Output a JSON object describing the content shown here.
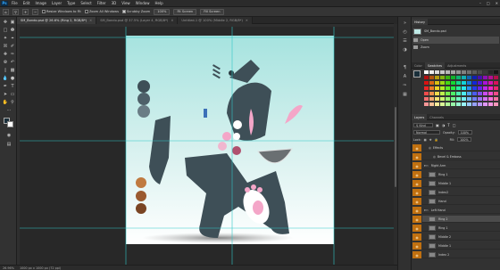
{
  "menu": {
    "items": [
      "File",
      "Edit",
      "Image",
      "Layer",
      "Type",
      "Select",
      "Filter",
      "3D",
      "View",
      "Window",
      "Help"
    ],
    "app_icon": "Ps"
  },
  "options": {
    "resize_windows": "Resize Windows to Fit",
    "zoom_all": "Zoom All Windows",
    "scrubby": "Scrubby Zoom",
    "zoom_value": "100%",
    "fit_screen": "Fit Screen",
    "fill_screen": "Fill Screen"
  },
  "tabs": [
    {
      "label": "SM_Bondo.psd @ 26.6% (Ring 2, RGB/8*)",
      "active": true
    },
    {
      "label": "SM_Bondo.psd @ 37.5% (Layer 4, RGB/8*)",
      "active": false
    },
    {
      "label": "Untitled-1 @ 100% (Middle 2, RGB/8*)",
      "active": false
    }
  ],
  "status": {
    "zoom": "26.96%",
    "doc": "1000 px x 1000 px (72 ppi)"
  },
  "history": {
    "tab": "History",
    "other_tab": "",
    "snapshot": "SM_Bondo.psd",
    "items": [
      "Open",
      "Zoom"
    ]
  },
  "swatches": {
    "tabs": [
      "Color",
      "Swatches",
      "Adjustments"
    ],
    "active": "Swatches"
  },
  "layers": {
    "tabs": [
      "Layers",
      "Channels"
    ],
    "kind_label": "Kind",
    "mode": "Normal",
    "opacity_label": "Opacity:",
    "opacity": "100%",
    "lock_label": "Lock:",
    "fill_label": "Fill:",
    "fill": "100%",
    "rows": [
      {
        "name": "Effects",
        "indent": 1,
        "type": "fx"
      },
      {
        "name": "Bevel & Emboss",
        "indent": 2,
        "type": "fx"
      },
      {
        "name": "Right Arm",
        "indent": 0,
        "type": "group"
      },
      {
        "name": "Ring 1",
        "indent": 1,
        "type": "layer"
      },
      {
        "name": "Middle 1",
        "indent": 1,
        "type": "layer"
      },
      {
        "name": "Index2",
        "indent": 1,
        "type": "layer"
      },
      {
        "name": "Hand",
        "indent": 1,
        "type": "layer"
      },
      {
        "name": "Left Hand",
        "indent": 0,
        "type": "group"
      },
      {
        "name": "Ring 2",
        "indent": 1,
        "type": "layer",
        "selected": true
      },
      {
        "name": "Ring 1",
        "indent": 1,
        "type": "layer"
      },
      {
        "name": "Middle 2",
        "indent": 1,
        "type": "layer"
      },
      {
        "name": "Middle 1",
        "indent": 1,
        "type": "layer"
      },
      {
        "name": "Index 2",
        "indent": 1,
        "type": "layer"
      }
    ]
  },
  "colors": {
    "accent": "#31a8ff",
    "eye": "#c07010",
    "canvas_top": "#a9e4e0",
    "canvas_bottom": "#ffffff",
    "character": "#3e4f57",
    "guide": "#2fc7c7",
    "pink": "#f09cc0"
  }
}
